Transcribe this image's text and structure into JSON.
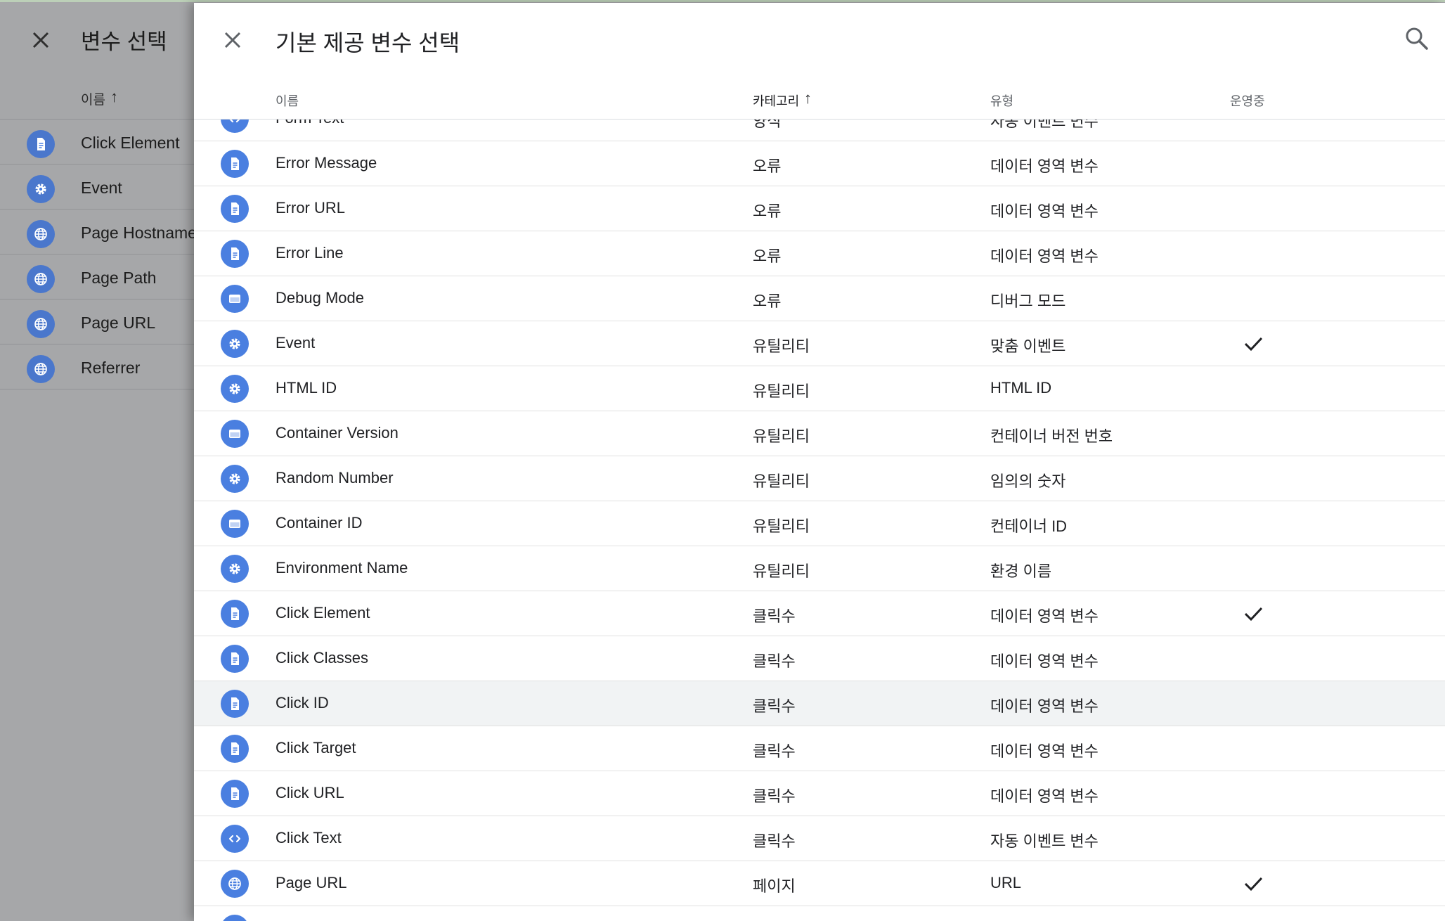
{
  "background_panel": {
    "title": "변수 선택",
    "column_name": "이름",
    "sort_arrow": "↑",
    "rows": [
      {
        "name": "Click Element",
        "icon": "document-icon"
      },
      {
        "name": "Event",
        "icon": "gear-icon"
      },
      {
        "name": "Page Hostname",
        "icon": "globe-icon"
      },
      {
        "name": "Page Path",
        "icon": "globe-icon"
      },
      {
        "name": "Page URL",
        "icon": "globe-icon"
      },
      {
        "name": "Referrer",
        "icon": "globe-icon"
      }
    ]
  },
  "sheet": {
    "title": "기본 제공 변수 선택",
    "columns": {
      "name": "이름",
      "category": "카테고리",
      "type": "유형",
      "live": "운영중"
    },
    "sort_arrow": "↑",
    "rows": [
      {
        "name": "Form Text",
        "category": "양식",
        "type": "자동 이벤트 변수",
        "live": false,
        "icon": "code-icon"
      },
      {
        "name": "Error Message",
        "category": "오류",
        "type": "데이터 영역 변수",
        "live": false,
        "icon": "document-icon"
      },
      {
        "name": "Error URL",
        "category": "오류",
        "type": "데이터 영역 변수",
        "live": false,
        "icon": "document-icon"
      },
      {
        "name": "Error Line",
        "category": "오류",
        "type": "데이터 영역 변수",
        "live": false,
        "icon": "document-icon"
      },
      {
        "name": "Debug Mode",
        "category": "오류",
        "type": "디버그 모드",
        "live": false,
        "icon": "window-icon"
      },
      {
        "name": "Event",
        "category": "유틸리티",
        "type": "맞춤 이벤트",
        "live": true,
        "icon": "gear-icon"
      },
      {
        "name": "HTML ID",
        "category": "유틸리티",
        "type": "HTML ID",
        "live": false,
        "icon": "gear-icon"
      },
      {
        "name": "Container Version",
        "category": "유틸리티",
        "type": "컨테이너 버전 번호",
        "live": false,
        "icon": "window-icon"
      },
      {
        "name": "Random Number",
        "category": "유틸리티",
        "type": "임의의 숫자",
        "live": false,
        "icon": "gear-icon"
      },
      {
        "name": "Container ID",
        "category": "유틸리티",
        "type": "컨테이너 ID",
        "live": false,
        "icon": "window-icon"
      },
      {
        "name": "Environment Name",
        "category": "유틸리티",
        "type": "환경 이름",
        "live": false,
        "icon": "gear-icon"
      },
      {
        "name": "Click Element",
        "category": "클릭수",
        "type": "데이터 영역 변수",
        "live": true,
        "icon": "document-icon"
      },
      {
        "name": "Click Classes",
        "category": "클릭수",
        "type": "데이터 영역 변수",
        "live": false,
        "icon": "document-icon"
      },
      {
        "name": "Click ID",
        "category": "클릭수",
        "type": "데이터 영역 변수",
        "live": false,
        "icon": "document-icon",
        "highlighted": true
      },
      {
        "name": "Click Target",
        "category": "클릭수",
        "type": "데이터 영역 변수",
        "live": false,
        "icon": "document-icon"
      },
      {
        "name": "Click URL",
        "category": "클릭수",
        "type": "데이터 영역 변수",
        "live": false,
        "icon": "document-icon"
      },
      {
        "name": "Click Text",
        "category": "클릭수",
        "type": "자동 이벤트 변수",
        "live": false,
        "icon": "code-icon"
      },
      {
        "name": "Page URL",
        "category": "페이지",
        "type": "URL",
        "live": true,
        "icon": "globe-icon"
      },
      {
        "name": "",
        "category": "",
        "type": "",
        "live": false,
        "icon": "globe-icon"
      }
    ]
  },
  "colors": {
    "icon_blue": "#4a7fe0",
    "overlay_gray": "#a6a7a9",
    "row_highlight": "#f1f3f4"
  }
}
